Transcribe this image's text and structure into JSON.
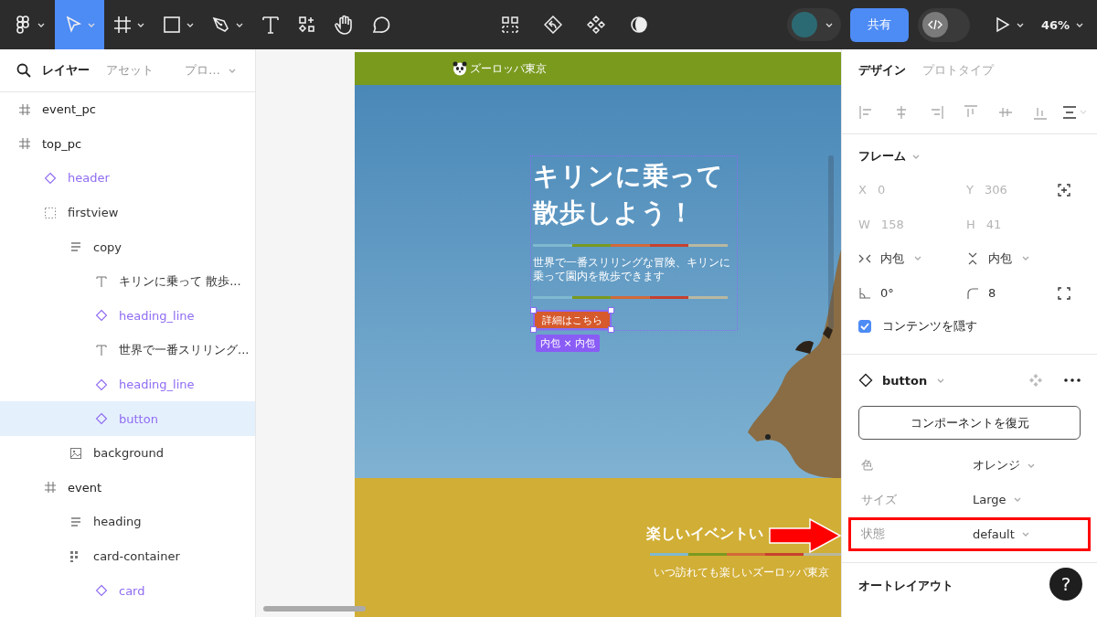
{
  "toolbar": {
    "tools": [
      {
        "kind": "logo",
        "selected": false,
        "menu": true
      },
      {
        "kind": "move",
        "selected": true,
        "menu": true
      },
      {
        "kind": "frame",
        "selected": false,
        "menu": true
      },
      {
        "kind": "rectangle",
        "selected": false,
        "menu": true
      },
      {
        "kind": "pen",
        "selected": false,
        "menu": true
      },
      {
        "kind": "text",
        "selected": false,
        "menu": false
      },
      {
        "kind": "resources",
        "selected": false,
        "menu": false
      },
      {
        "kind": "hand",
        "selected": false,
        "menu": false
      },
      {
        "kind": "comment",
        "selected": false,
        "menu": false
      }
    ],
    "center_tools": [
      {
        "kind": "dashed-grid"
      },
      {
        "kind": "return"
      },
      {
        "kind": "components"
      },
      {
        "kind": "contrast"
      }
    ],
    "share_button": "共有",
    "dev_mode": {
      "on": false
    },
    "zoom": "46%"
  },
  "left_panel": {
    "tabs": [
      {
        "label": "レイヤー",
        "selected": true
      },
      {
        "label": "アセット",
        "selected": false
      },
      {
        "label": "プロ…",
        "selected": false,
        "menu": true
      }
    ],
    "layers": [
      {
        "name": "event_pc",
        "kind": "frame",
        "selected": false
      },
      {
        "name": "top_pc",
        "kind": "frame",
        "selected": false,
        "children": [
          {
            "name": "header",
            "kind": "instance",
            "selected": false
          },
          {
            "name": "firstview",
            "kind": "section",
            "selected": false,
            "children": [
              {
                "name": "copy",
                "kind": "stack",
                "selected": false,
                "children": [
                  {
                    "name": "キリンに乗って 散歩...",
                    "kind": "text",
                    "selected": false
                  },
                  {
                    "name": "heading_line",
                    "kind": "instance",
                    "selected": false
                  },
                  {
                    "name": "世界で一番スリリング...",
                    "kind": "text",
                    "selected": false
                  },
                  {
                    "name": "heading_line",
                    "kind": "instance",
                    "selected": false
                  },
                  {
                    "name": "button",
                    "kind": "instance",
                    "selected": true
                  }
                ]
              },
              {
                "name": "background",
                "kind": "image",
                "selected": false
              }
            ]
          },
          {
            "name": "event",
            "kind": "frame",
            "selected": false,
            "children": [
              {
                "name": "heading",
                "kind": "stack",
                "selected": false
              },
              {
                "name": "card-container",
                "kind": "grid",
                "selected": false,
                "children": [
                  {
                    "name": "card",
                    "kind": "instance",
                    "selected": false
                  }
                ]
              }
            ]
          }
        ]
      }
    ]
  },
  "canvas": {
    "site": {
      "logo_text": "ズーロッパ東京",
      "hero": {
        "heading_lines": [
          "キリンに乗って",
          "散歩しよう！"
        ],
        "text": "世界で一番スリリングな冒険、キリンに乗って園内を散歩できます",
        "button": "詳細はこちら",
        "size_badge": "内包 × 内包"
      },
      "event": {
        "heading": "楽しいイベントい",
        "subtitle": "いつ訪れても楽しいズーロッパ東京"
      }
    }
  },
  "right_panel": {
    "tabs": [
      {
        "label": "デザイン",
        "selected": true
      },
      {
        "label": "プロトタイプ",
        "selected": false
      }
    ],
    "frame": {
      "title": "フレーム",
      "fields": [
        {
          "label": "X",
          "value": "0",
          "disabled": true
        },
        {
          "label": "Y",
          "value": "306",
          "disabled": true
        },
        {
          "label": "W",
          "value": "158",
          "disabled": true
        },
        {
          "label": "H",
          "value": "41",
          "disabled": true
        }
      ],
      "resizing": [
        {
          "kind": "horizontal",
          "value": "内包"
        },
        {
          "kind": "vertical",
          "value": "内包"
        }
      ],
      "rotation": "0°",
      "radius": "8",
      "clip_content": {
        "label": "コンテンツを隠す",
        "checked": true
      }
    },
    "instance": {
      "name": "button",
      "reset_button": "コンポーネントを復元",
      "properties": [
        {
          "label": "色",
          "value": "オレンジ",
          "highlighted": false
        },
        {
          "label": "サイズ",
          "value": "Large",
          "highlighted": false
        },
        {
          "label": "状態",
          "value": "default",
          "highlighted": true
        }
      ]
    },
    "next_section": "オートレイアウト",
    "help_button": "?"
  }
}
